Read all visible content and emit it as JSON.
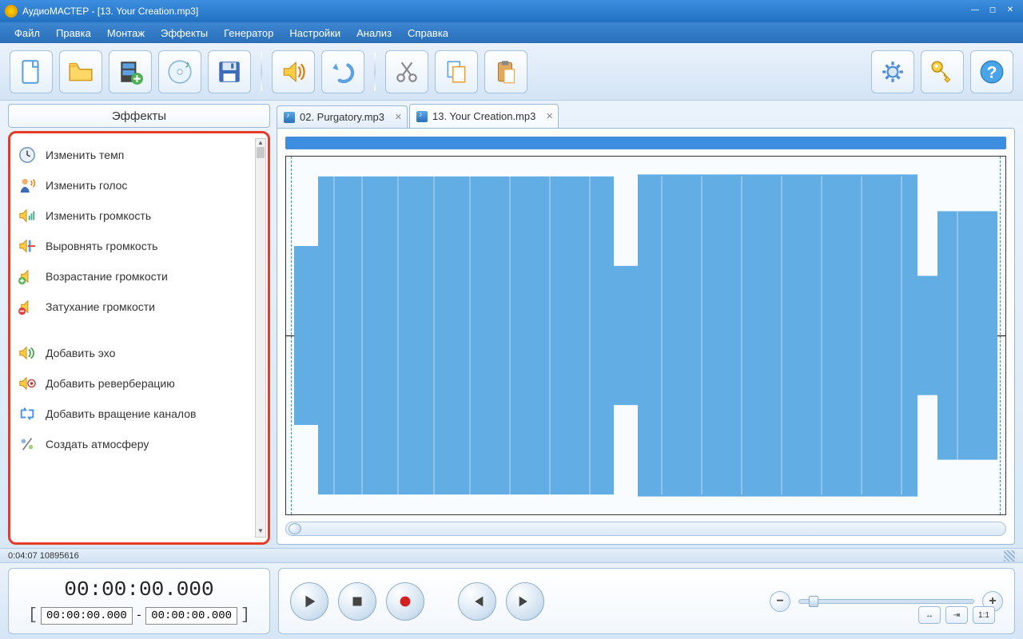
{
  "window": {
    "title": "АудиоМАСТЕР - [13. Your Creation.mp3]"
  },
  "menu": {
    "file": "Файл",
    "edit": "Правка",
    "montage": "Монтаж",
    "effects": "Эффекты",
    "generator": "Генератор",
    "settings": "Настройки",
    "analysis": "Анализ",
    "help": "Справка"
  },
  "effects_panel": {
    "title": "Эффекты"
  },
  "effects": {
    "tempo": "Изменить темп",
    "voice": "Изменить голос",
    "volume": "Изменить громкость",
    "normalize": "Выровнять громкость",
    "fadein": "Возрастание громкости",
    "fadeout": "Затухание громкости",
    "echo": "Добавить эхо",
    "reverb": "Добавить реверберацию",
    "rotate": "Добавить вращение каналов",
    "atmosphere": "Создать атмосферу"
  },
  "tabs": {
    "tab1": "02. Purgatory.mp3",
    "tab2": "13. Your Creation.mp3"
  },
  "status": {
    "text": "0:04:07 10895616"
  },
  "time": {
    "main": "00:00:00.000",
    "from": "00:00:00.000",
    "to": "00:00:00.000",
    "sep": "-"
  },
  "fit": {
    "ratio": "1:1"
  }
}
